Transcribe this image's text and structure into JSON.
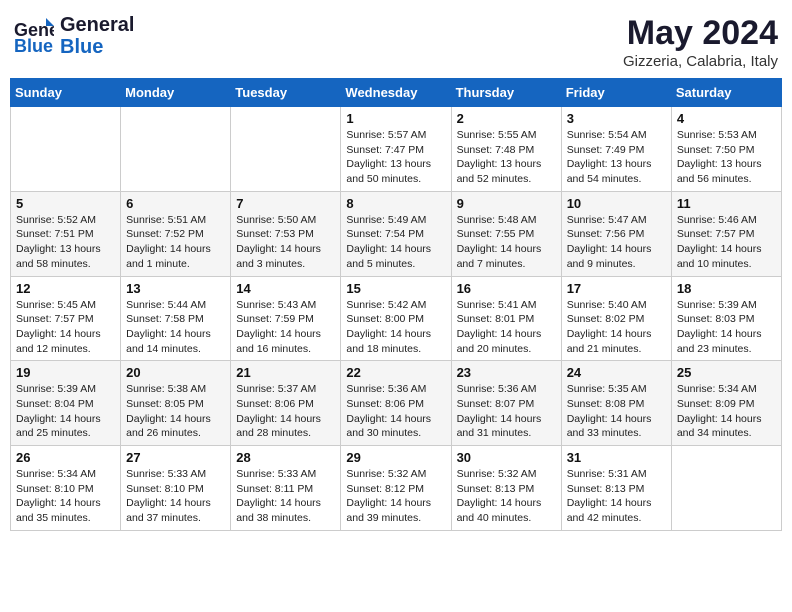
{
  "header": {
    "logo_general": "General",
    "logo_blue": "Blue",
    "month": "May 2024",
    "location": "Gizzeria, Calabria, Italy"
  },
  "weekdays": [
    "Sunday",
    "Monday",
    "Tuesday",
    "Wednesday",
    "Thursday",
    "Friday",
    "Saturday"
  ],
  "weeks": [
    [
      {
        "day": "",
        "info": ""
      },
      {
        "day": "",
        "info": ""
      },
      {
        "day": "",
        "info": ""
      },
      {
        "day": "1",
        "info": "Sunrise: 5:57 AM\nSunset: 7:47 PM\nDaylight: 13 hours\nand 50 minutes."
      },
      {
        "day": "2",
        "info": "Sunrise: 5:55 AM\nSunset: 7:48 PM\nDaylight: 13 hours\nand 52 minutes."
      },
      {
        "day": "3",
        "info": "Sunrise: 5:54 AM\nSunset: 7:49 PM\nDaylight: 13 hours\nand 54 minutes."
      },
      {
        "day": "4",
        "info": "Sunrise: 5:53 AM\nSunset: 7:50 PM\nDaylight: 13 hours\nand 56 minutes."
      }
    ],
    [
      {
        "day": "5",
        "info": "Sunrise: 5:52 AM\nSunset: 7:51 PM\nDaylight: 13 hours\nand 58 minutes."
      },
      {
        "day": "6",
        "info": "Sunrise: 5:51 AM\nSunset: 7:52 PM\nDaylight: 14 hours\nand 1 minute."
      },
      {
        "day": "7",
        "info": "Sunrise: 5:50 AM\nSunset: 7:53 PM\nDaylight: 14 hours\nand 3 minutes."
      },
      {
        "day": "8",
        "info": "Sunrise: 5:49 AM\nSunset: 7:54 PM\nDaylight: 14 hours\nand 5 minutes."
      },
      {
        "day": "9",
        "info": "Sunrise: 5:48 AM\nSunset: 7:55 PM\nDaylight: 14 hours\nand 7 minutes."
      },
      {
        "day": "10",
        "info": "Sunrise: 5:47 AM\nSunset: 7:56 PM\nDaylight: 14 hours\nand 9 minutes."
      },
      {
        "day": "11",
        "info": "Sunrise: 5:46 AM\nSunset: 7:57 PM\nDaylight: 14 hours\nand 10 minutes."
      }
    ],
    [
      {
        "day": "12",
        "info": "Sunrise: 5:45 AM\nSunset: 7:57 PM\nDaylight: 14 hours\nand 12 minutes."
      },
      {
        "day": "13",
        "info": "Sunrise: 5:44 AM\nSunset: 7:58 PM\nDaylight: 14 hours\nand 14 minutes."
      },
      {
        "day": "14",
        "info": "Sunrise: 5:43 AM\nSunset: 7:59 PM\nDaylight: 14 hours\nand 16 minutes."
      },
      {
        "day": "15",
        "info": "Sunrise: 5:42 AM\nSunset: 8:00 PM\nDaylight: 14 hours\nand 18 minutes."
      },
      {
        "day": "16",
        "info": "Sunrise: 5:41 AM\nSunset: 8:01 PM\nDaylight: 14 hours\nand 20 minutes."
      },
      {
        "day": "17",
        "info": "Sunrise: 5:40 AM\nSunset: 8:02 PM\nDaylight: 14 hours\nand 21 minutes."
      },
      {
        "day": "18",
        "info": "Sunrise: 5:39 AM\nSunset: 8:03 PM\nDaylight: 14 hours\nand 23 minutes."
      }
    ],
    [
      {
        "day": "19",
        "info": "Sunrise: 5:39 AM\nSunset: 8:04 PM\nDaylight: 14 hours\nand 25 minutes."
      },
      {
        "day": "20",
        "info": "Sunrise: 5:38 AM\nSunset: 8:05 PM\nDaylight: 14 hours\nand 26 minutes."
      },
      {
        "day": "21",
        "info": "Sunrise: 5:37 AM\nSunset: 8:06 PM\nDaylight: 14 hours\nand 28 minutes."
      },
      {
        "day": "22",
        "info": "Sunrise: 5:36 AM\nSunset: 8:06 PM\nDaylight: 14 hours\nand 30 minutes."
      },
      {
        "day": "23",
        "info": "Sunrise: 5:36 AM\nSunset: 8:07 PM\nDaylight: 14 hours\nand 31 minutes."
      },
      {
        "day": "24",
        "info": "Sunrise: 5:35 AM\nSunset: 8:08 PM\nDaylight: 14 hours\nand 33 minutes."
      },
      {
        "day": "25",
        "info": "Sunrise: 5:34 AM\nSunset: 8:09 PM\nDaylight: 14 hours\nand 34 minutes."
      }
    ],
    [
      {
        "day": "26",
        "info": "Sunrise: 5:34 AM\nSunset: 8:10 PM\nDaylight: 14 hours\nand 35 minutes."
      },
      {
        "day": "27",
        "info": "Sunrise: 5:33 AM\nSunset: 8:10 PM\nDaylight: 14 hours\nand 37 minutes."
      },
      {
        "day": "28",
        "info": "Sunrise: 5:33 AM\nSunset: 8:11 PM\nDaylight: 14 hours\nand 38 minutes."
      },
      {
        "day": "29",
        "info": "Sunrise: 5:32 AM\nSunset: 8:12 PM\nDaylight: 14 hours\nand 39 minutes."
      },
      {
        "day": "30",
        "info": "Sunrise: 5:32 AM\nSunset: 8:13 PM\nDaylight: 14 hours\nand 40 minutes."
      },
      {
        "day": "31",
        "info": "Sunrise: 5:31 AM\nSunset: 8:13 PM\nDaylight: 14 hours\nand 42 minutes."
      },
      {
        "day": "",
        "info": ""
      }
    ]
  ]
}
